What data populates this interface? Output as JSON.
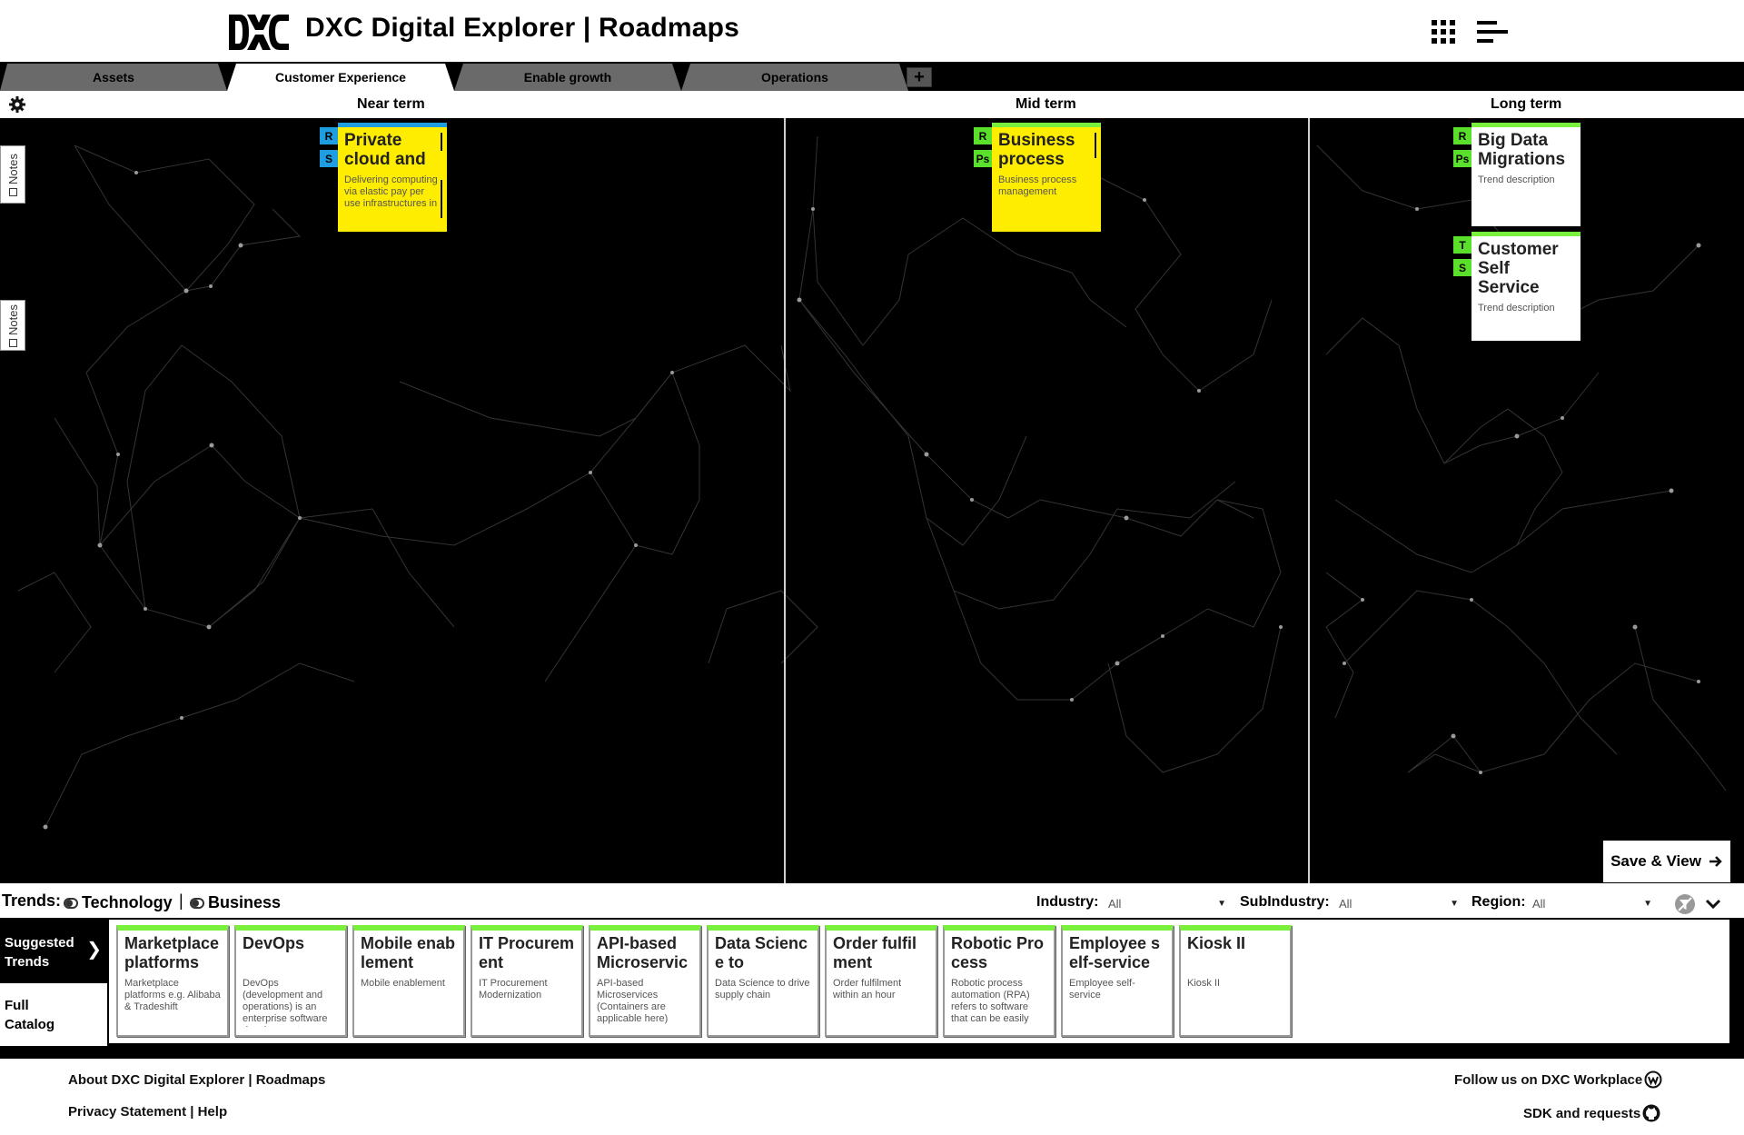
{
  "header": {
    "logo_text": "DXC",
    "app_title": "DXC Digital Explorer | Roadmaps",
    "grid_menu_icon": "apps-grid-icon",
    "menu_icon": "hamburger-menu-icon"
  },
  "tabs": [
    {
      "label": "Assets",
      "active": false
    },
    {
      "label": "Customer Experience",
      "active": true
    },
    {
      "label": "Enable growth",
      "active": false
    },
    {
      "label": "Operations",
      "active": false
    }
  ],
  "tab_add_label": "+",
  "columns": {
    "near": "Near term",
    "mid": "Mid term",
    "long": "Long term"
  },
  "notes": [
    "Notes",
    "Notes"
  ],
  "canvas_cards": [
    {
      "title": "Private cloud and",
      "description": "Delivering computing via elastic pay per use infrastructures in",
      "badges": [
        "R",
        "S"
      ],
      "color": "yellow",
      "accent": "blue"
    },
    {
      "title": "Business process",
      "description": "Business process management",
      "badges": [
        "R",
        "Ps"
      ],
      "color": "yellow",
      "accent": "green"
    },
    {
      "title": "Big Data Migrations",
      "description": "Trend description",
      "badges": [
        "R",
        "Ps"
      ],
      "color": "white",
      "accent": "green"
    },
    {
      "title": "Customer Self Service",
      "description": "Trend description",
      "badges": [
        "T",
        "S"
      ],
      "color": "white",
      "accent": "green"
    }
  ],
  "save_view": "Save & View",
  "filters": {
    "trends_label": "Trends:",
    "technology": "Technology",
    "separator": "|",
    "business": "Business",
    "industry_label": "Industry:",
    "industry_value": "All",
    "subindustry_label": "SubIndustry:",
    "subindustry_value": "All",
    "region_label": "Region:",
    "region_value": "All"
  },
  "catalog": {
    "suggested": "Suggested Trends",
    "full": "Full Catalog",
    "cards": [
      {
        "title": "Marketplace platforms",
        "description": "Marketplace platforms e.g. Alibaba & Tradeshift"
      },
      {
        "title": "DevOps",
        "description": "DevOps (development and operations) is an enterprise software development"
      },
      {
        "title": "Mobile enablement",
        "description": "Mobile enablement"
      },
      {
        "title": "IT Procurement",
        "description": "IT Procurement Modernization"
      },
      {
        "title": "API-based Microservices",
        "description": "API-based Microservices (Containers are applicable here)"
      },
      {
        "title": "Data Science to",
        "description": "Data Science to drive supply chain"
      },
      {
        "title": "Order fulfilment",
        "description": "Order fulfilment within an hour"
      },
      {
        "title": "Robotic Process",
        "description": "Robotic process automation (RPA) refers to software that can be easily"
      },
      {
        "title": "Employee self-service",
        "description": "Employee self-service"
      },
      {
        "title": "Kiosk II",
        "description": "Kiosk II"
      }
    ]
  },
  "footer": {
    "about": "About DXC Digital Explorer | Roadmaps",
    "privacy": "Privacy Statement | Help",
    "follow": "Follow us on DXC Workplace",
    "sdk": "SDK and requests"
  },
  "colors": {
    "accent_green": "#78f03c",
    "accent_blue": "#1e9ee0",
    "card_yellow": "#ffed00",
    "canvas_bg": "#000000"
  }
}
